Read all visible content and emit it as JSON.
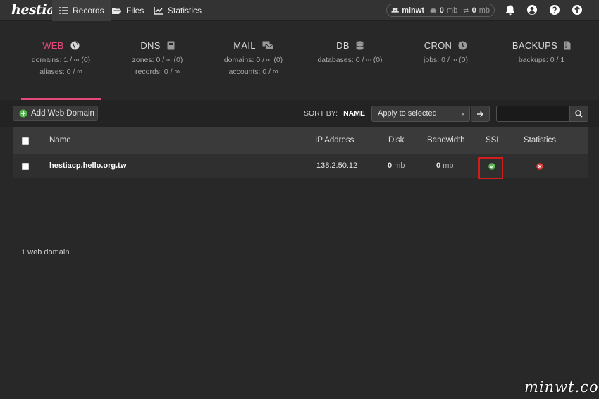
{
  "app": {
    "logo": "hestia"
  },
  "nav": {
    "records": "Records",
    "files": "Files",
    "statistics": "Statistics"
  },
  "user": {
    "name": "minwt",
    "disk_value": "0",
    "disk_unit": "mb",
    "bw_value": "0",
    "bw_unit": "mb"
  },
  "stats": {
    "web": {
      "title": "WEB",
      "line1": "domains: 1 / ∞ (0)",
      "line2": "aliases: 0 / ∞"
    },
    "dns": {
      "title": "DNS",
      "line1": "zones: 0 / ∞ (0)",
      "line2": "records: 0 / ∞"
    },
    "mail": {
      "title": "MAIL",
      "line1": "domains: 0 / ∞ (0)",
      "line2": "accounts: 0 / ∞"
    },
    "db": {
      "title": "DB",
      "line1": "databases: 0 / ∞ (0)"
    },
    "cron": {
      "title": "CRON",
      "line1": "jobs: 0 / ∞ (0)"
    },
    "backups": {
      "title": "BACKUPS",
      "line1": "backups: 0 / 1"
    }
  },
  "toolbar": {
    "add_label": "Add Web Domain",
    "sort_by": "SORT BY:",
    "sort_field": "NAME",
    "bulk_action": "Apply to selected",
    "search_value": ""
  },
  "table": {
    "headers": {
      "name": "Name",
      "ip": "IP Address",
      "disk": "Disk",
      "bandwidth": "Bandwidth",
      "ssl": "SSL",
      "statistics": "Statistics"
    },
    "rows": [
      {
        "name": "hestiacp.hello.org.tw",
        "ip": "138.2.50.12",
        "disk_value": "0",
        "disk_unit": "mb",
        "bw_value": "0",
        "bw_unit": "mb",
        "ssl": "enabled",
        "statistics": "disabled"
      }
    ]
  },
  "footer": {
    "count": "1 web domain"
  },
  "watermark": "minwt.com",
  "colors": {
    "accent": "#e5497a",
    "ok": "#5ab552",
    "error": "#e03b3b",
    "highlight_box": "#d01e1e"
  }
}
